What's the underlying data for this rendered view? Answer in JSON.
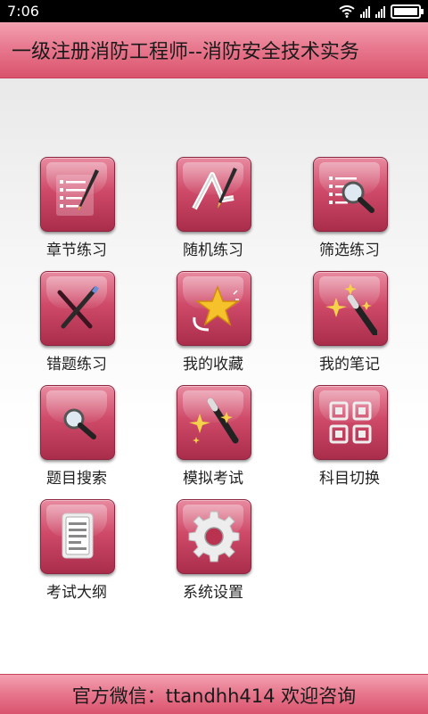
{
  "status_bar": {
    "time": "7:06",
    "icons": [
      "wifi-icon",
      "signal-icon",
      "signal-icon",
      "battery-icon"
    ]
  },
  "header": {
    "title": "一级注册消防工程师--消防安全技术实务"
  },
  "menu": {
    "items": [
      {
        "label": "章节练习",
        "icon": "list-pen-icon"
      },
      {
        "label": "随机练习",
        "icon": "random-pen-icon"
      },
      {
        "label": "筛选练习",
        "icon": "list-magnifier-icon"
      },
      {
        "label": "错题练习",
        "icon": "cross-pens-icon"
      },
      {
        "label": "我的收藏",
        "icon": "star-icon"
      },
      {
        "label": "我的笔记",
        "icon": "magic-wand-icon"
      },
      {
        "label": "题目搜索",
        "icon": "magnifier-icon"
      },
      {
        "label": "模拟考试",
        "icon": "magic-wand-icon"
      },
      {
        "label": "科目切换",
        "icon": "grid-icon"
      },
      {
        "label": "考试大纲",
        "icon": "document-icon"
      },
      {
        "label": "系统设置",
        "icon": "gear-icon"
      }
    ]
  },
  "footer": {
    "text": "官方微信：ttandhh414 欢迎咨询"
  },
  "colors": {
    "accent": "#d9536d",
    "tile": "#c13e5d"
  }
}
